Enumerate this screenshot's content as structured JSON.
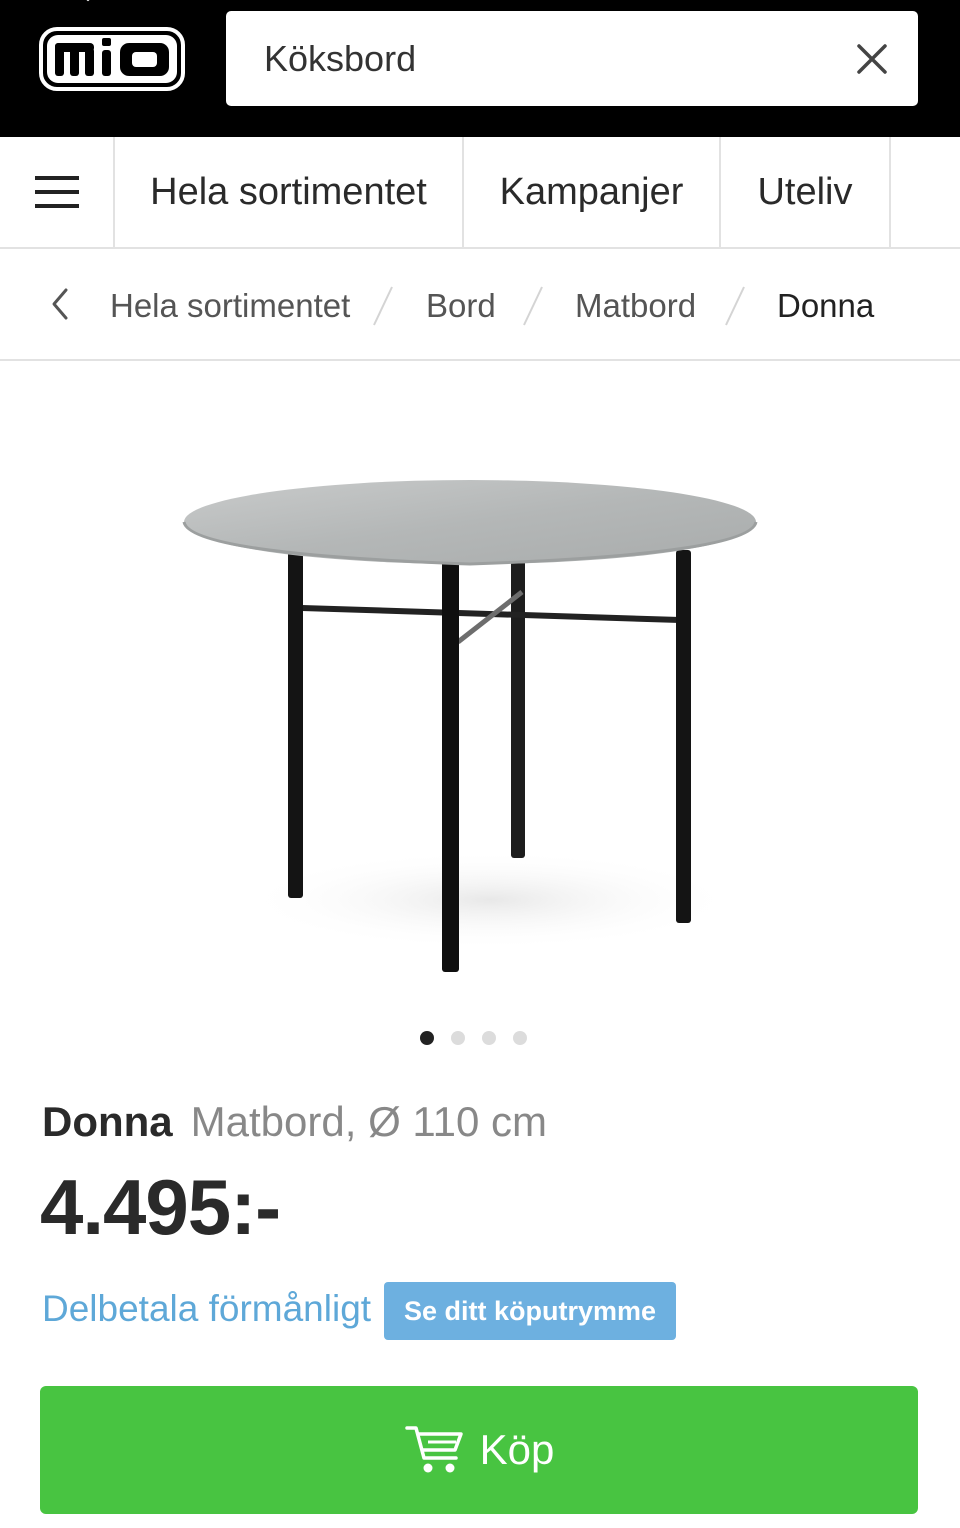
{
  "header": {
    "logo_text": "mio",
    "search_value": "Köksbord",
    "search_placeholder": ""
  },
  "nav": {
    "items": [
      {
        "label": "Hela sortimentet"
      },
      {
        "label": "Kampanjer"
      },
      {
        "label": "Uteliv"
      }
    ]
  },
  "breadcrumb": {
    "items": [
      {
        "label": "Hela sortimentet"
      },
      {
        "label": "Bord"
      },
      {
        "label": "Matbord"
      },
      {
        "label": "Donna"
      }
    ]
  },
  "carousel": {
    "total": 4,
    "active": 1
  },
  "product": {
    "name": "Donna",
    "description": "Matbord, Ø 110 cm",
    "price": "4.495:-",
    "finance_link": "Delbetala förmånligt",
    "credit_button": "Se ditt köputrymme",
    "buy_label": "Köp"
  },
  "colors": {
    "header_bg": "#000000",
    "buy_green": "#48c441",
    "link_blue": "#5ea8d8",
    "credit_blue": "#6db0e0"
  },
  "icons": [
    "close-icon",
    "clear-search-icon",
    "hamburger-menu-icon",
    "chevron-left-icon",
    "cart-icon"
  ]
}
